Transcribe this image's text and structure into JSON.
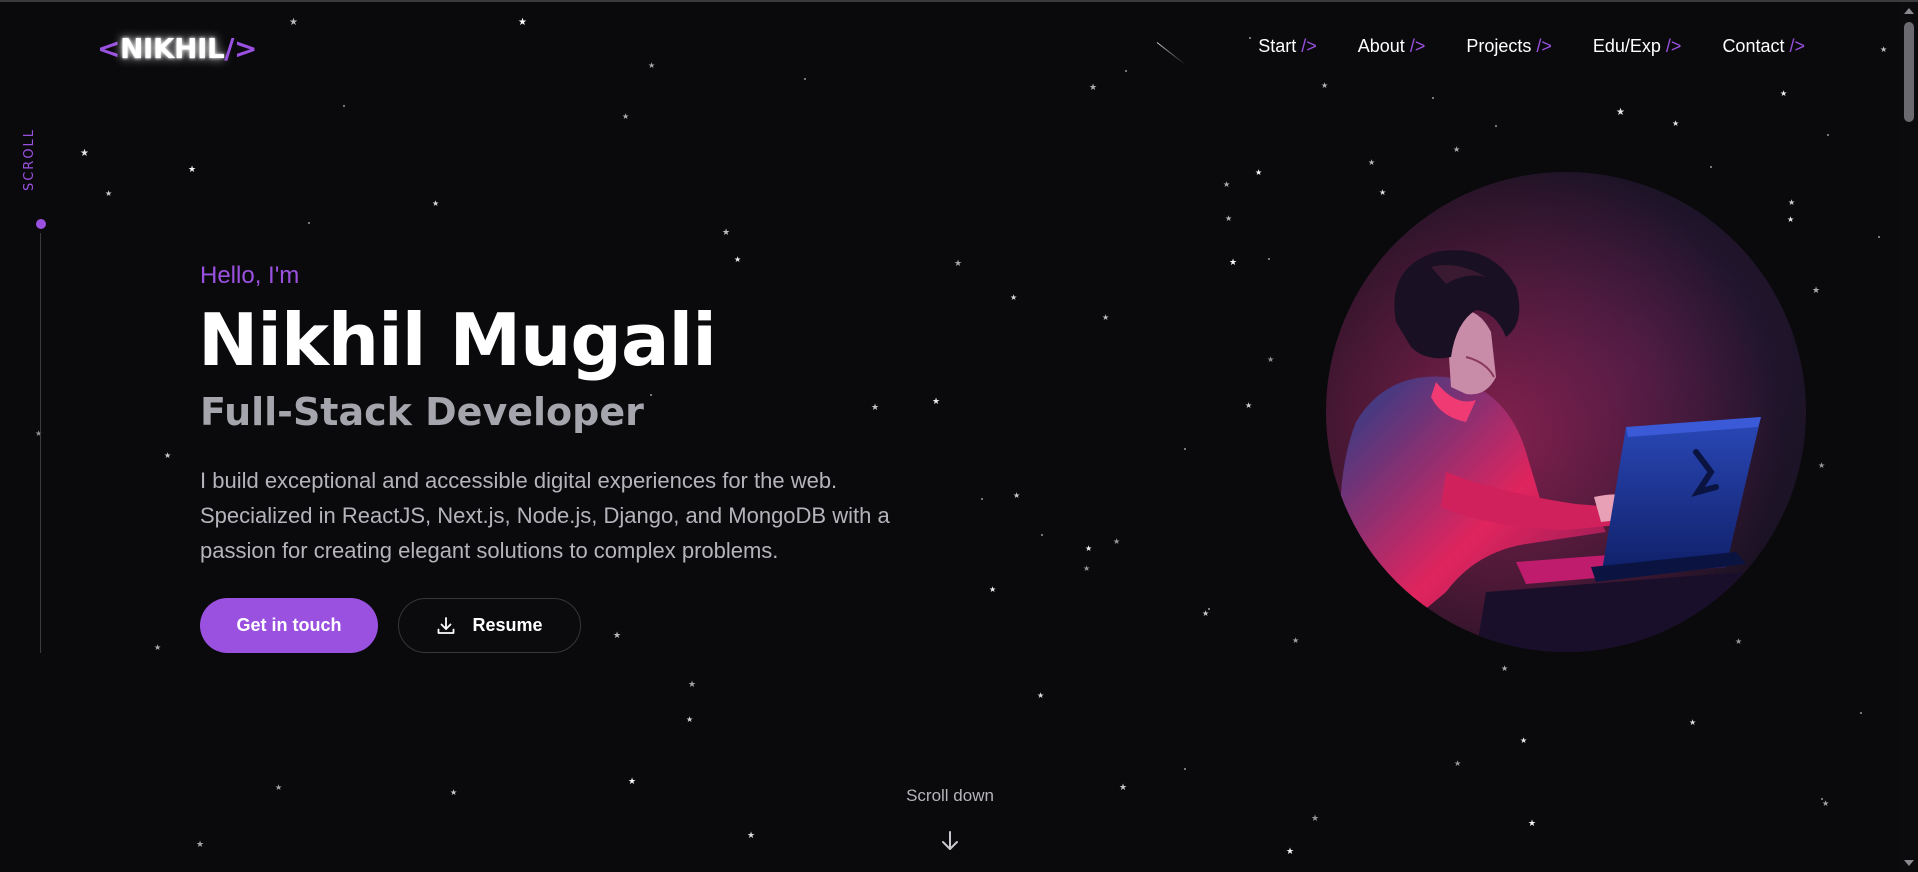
{
  "logo": {
    "open": "<",
    "name": "NIKHIL",
    "close": "/>"
  },
  "nav": {
    "suffix": " />",
    "items": [
      {
        "label": "Start"
      },
      {
        "label": "About"
      },
      {
        "label": "Projects"
      },
      {
        "label": "Edu/Exp"
      },
      {
        "label": "Contact"
      }
    ]
  },
  "scroll_label": "SCROLL",
  "hero": {
    "greeting": "Hello, I'm",
    "name": "Nikhil Mugali",
    "role": "Full-Stack Developer",
    "description": "I build exceptional and accessible digital experiences for the web. Specialized in ReactJS, Next.js, Node.js, Django, and MongoDB with a passion for creating elegant solutions to complex problems."
  },
  "buttons": {
    "contact_label": "Get in touch",
    "resume_label": "Resume",
    "resume_icon": "download-icon"
  },
  "avatar": {
    "icon": "developer-illustration"
  },
  "scroll_down": {
    "label": "Scroll down",
    "icon": "arrow-down-icon"
  },
  "colors": {
    "accent": "#9b51e0",
    "background": "#0a0a0d",
    "text": "#ffffff",
    "muted": "#b4b4bb"
  }
}
